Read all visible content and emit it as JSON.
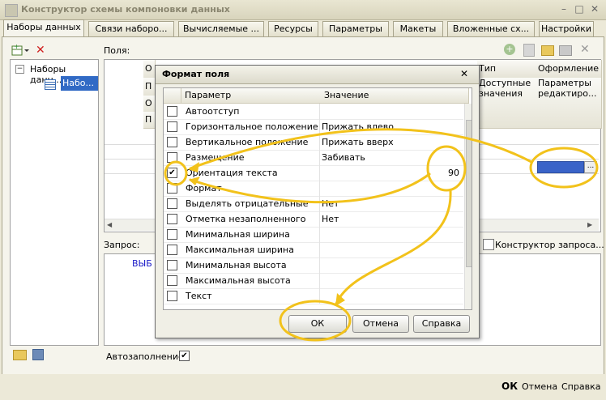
{
  "window": {
    "title": "Конструктор схемы компоновки данных"
  },
  "tabs": [
    {
      "label": "Наборы данных"
    },
    {
      "label": "Связи наборо..."
    },
    {
      "label": "Вычисляемые ..."
    },
    {
      "label": "Ресурсы"
    },
    {
      "label": "Параметры"
    },
    {
      "label": "Макеты"
    },
    {
      "label": "Вложенные сх..."
    },
    {
      "label": "Настройки"
    }
  ],
  "tree": {
    "root": "Наборы данн...",
    "child": "Набо..."
  },
  "fields": {
    "label": "Поля:",
    "header_type": "Тип значен...",
    "header_design": "Оформление",
    "header_avail": "Доступные значения",
    "header_params": "Параметры редактиро...",
    "header_left": [
      "О",
      "П",
      "О",
      "П"
    ]
  },
  "query": {
    "label": "Запрос:",
    "builder_button": "Конструктор запроса...",
    "text": "ВЫБ"
  },
  "autofill": {
    "label": "Автозаполнение",
    "checked": "✔"
  },
  "dialog": {
    "title": "Формат поля",
    "col_param": "Параметр",
    "col_value": "Значение",
    "rows": [
      {
        "name": "Автоотступ",
        "value": "",
        "checked": ""
      },
      {
        "name": "Горизонтальное положение",
        "value": "Прижать влево",
        "checked": ""
      },
      {
        "name": "Вертикальное положение",
        "value": "Прижать вверх",
        "checked": ""
      },
      {
        "name": "Размещение",
        "value": "Забивать",
        "checked": ""
      },
      {
        "name": "Ориентация текста",
        "value": "90",
        "checked": "✔"
      },
      {
        "name": "Формат",
        "value": "",
        "checked": ""
      },
      {
        "name": "Выделять отрицательные",
        "value": "Нет",
        "checked": ""
      },
      {
        "name": "Отметка незаполненного",
        "value": "Нет",
        "checked": ""
      },
      {
        "name": "Минимальная ширина",
        "value": "",
        "checked": ""
      },
      {
        "name": "Максимальная ширина",
        "value": "",
        "checked": ""
      },
      {
        "name": "Минимальная высота",
        "value": "",
        "checked": ""
      },
      {
        "name": "Максимальная высота",
        "value": "",
        "checked": ""
      },
      {
        "name": "Текст",
        "value": "",
        "checked": ""
      }
    ],
    "ok": "ОК",
    "cancel": "Отмена",
    "help": "Справка",
    "close": "✕"
  },
  "footer": {
    "ok": "ОК",
    "cancel": "Отмена",
    "help": "Справка"
  },
  "colors": {
    "annotation": "#f2c21b",
    "selection": "#3a63c8",
    "tree_select": "#316ac5"
  }
}
